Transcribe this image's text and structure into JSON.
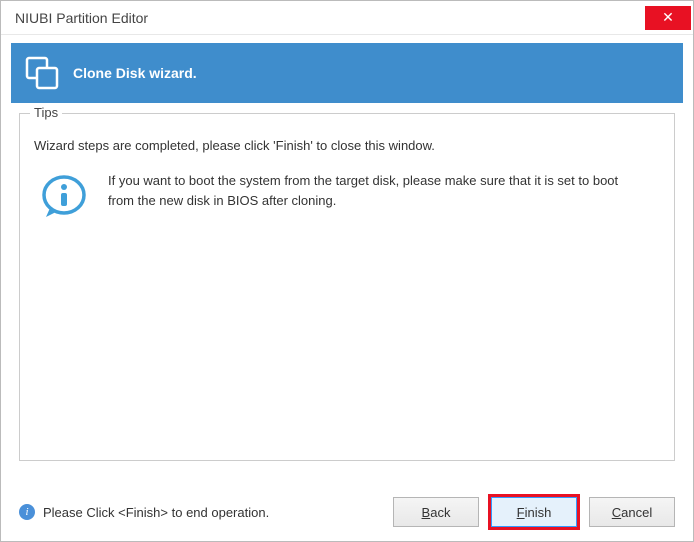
{
  "window": {
    "title": "NIUBI Partition Editor",
    "close_symbol": "✕"
  },
  "banner": {
    "title": "Clone Disk wizard."
  },
  "tips": {
    "legend": "Tips",
    "completed": "Wizard steps are completed, please click 'Finish' to close this window.",
    "info": "If you want to boot the system from the target disk, please make sure that it is set to boot from the new disk in BIOS after cloning."
  },
  "footer": {
    "hint": "Please Click <Finish> to end operation.",
    "back_key": "B",
    "back_rest": "ack",
    "finish_key": "F",
    "finish_rest": "inish",
    "cancel_key": "C",
    "cancel_rest": "ancel"
  }
}
